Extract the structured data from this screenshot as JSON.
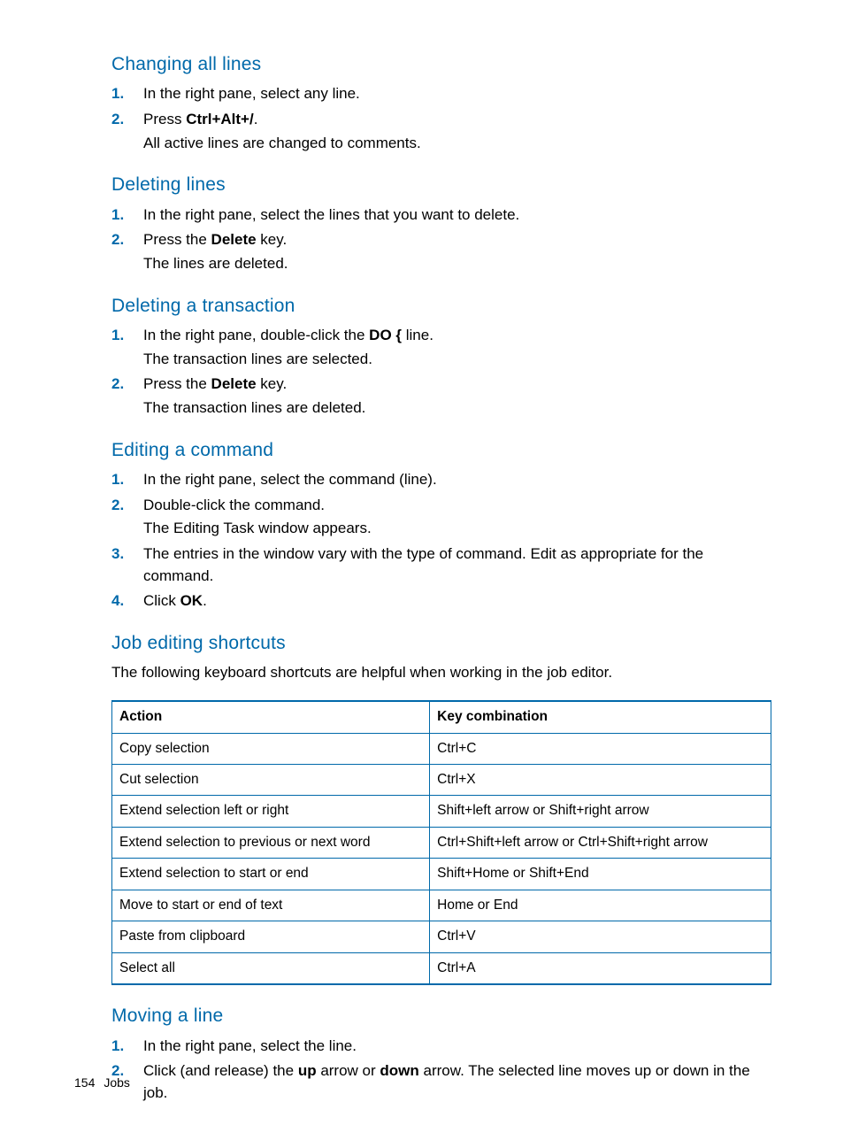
{
  "sections": {
    "changing_all_lines": {
      "heading": "Changing all lines",
      "step1": "In the right pane, select any line.",
      "step2_pre": "Press ",
      "step2_bold": "Ctrl+Alt+/",
      "step2_post": ".",
      "step2_result": "All active lines are changed to comments."
    },
    "deleting_lines": {
      "heading": "Deleting lines",
      "step1": "In the right pane, select the lines that you want to delete.",
      "step2_pre": "Press the ",
      "step2_bold": "Delete",
      "step2_post": " key.",
      "step2_result": "The lines are deleted."
    },
    "deleting_transaction": {
      "heading": "Deleting a transaction",
      "step1_pre": "In the right pane, double-click the ",
      "step1_bold": "DO {",
      "step1_post": " line.",
      "step1_result": "The transaction lines are selected.",
      "step2_pre": "Press the ",
      "step2_bold": "Delete",
      "step2_post": " key.",
      "step2_result": "The transaction lines are deleted."
    },
    "editing_command": {
      "heading": "Editing a command",
      "step1": "In the right pane, select the command (line).",
      "step2": "Double-click the command.",
      "step2_result": "The Editing Task window appears.",
      "step3": "The entries in the window vary with the type of command. Edit as appropriate for the command.",
      "step4_pre": "Click ",
      "step4_bold": "OK",
      "step4_post": "."
    },
    "job_shortcuts": {
      "heading": "Job editing shortcuts",
      "intro": "The following keyboard shortcuts are helpful when working in the job editor.",
      "table": {
        "headers": {
          "col1": "Action",
          "col2": "Key combination"
        },
        "rows": [
          {
            "action": "Copy selection",
            "keys": "Ctrl+C"
          },
          {
            "action": "Cut selection",
            "keys": "Ctrl+X"
          },
          {
            "action": "Extend selection left or right",
            "keys": "Shift+left arrow or Shift+right arrow"
          },
          {
            "action": "Extend selection to previous or next word",
            "keys": "Ctrl+Shift+left arrow or Ctrl+Shift+right arrow"
          },
          {
            "action": "Extend selection to start or end",
            "keys": "Shift+Home or Shift+End"
          },
          {
            "action": "Move to start or end of text",
            "keys": "Home or End"
          },
          {
            "action": "Paste from clipboard",
            "keys": "Ctrl+V"
          },
          {
            "action": "Select all",
            "keys": "Ctrl+A"
          }
        ]
      }
    },
    "moving_line": {
      "heading": "Moving a line",
      "step1": "In the right pane, select the line.",
      "step2_pre": "Click (and release) the ",
      "step2_b1": "up",
      "step2_mid": " arrow or ",
      "step2_b2": "down",
      "step2_post": " arrow. The selected line moves up or down in the job."
    }
  },
  "numbers": {
    "n1": "1.",
    "n2": "2.",
    "n3": "3.",
    "n4": "4."
  },
  "footer": {
    "page": "154",
    "section": "Jobs"
  }
}
